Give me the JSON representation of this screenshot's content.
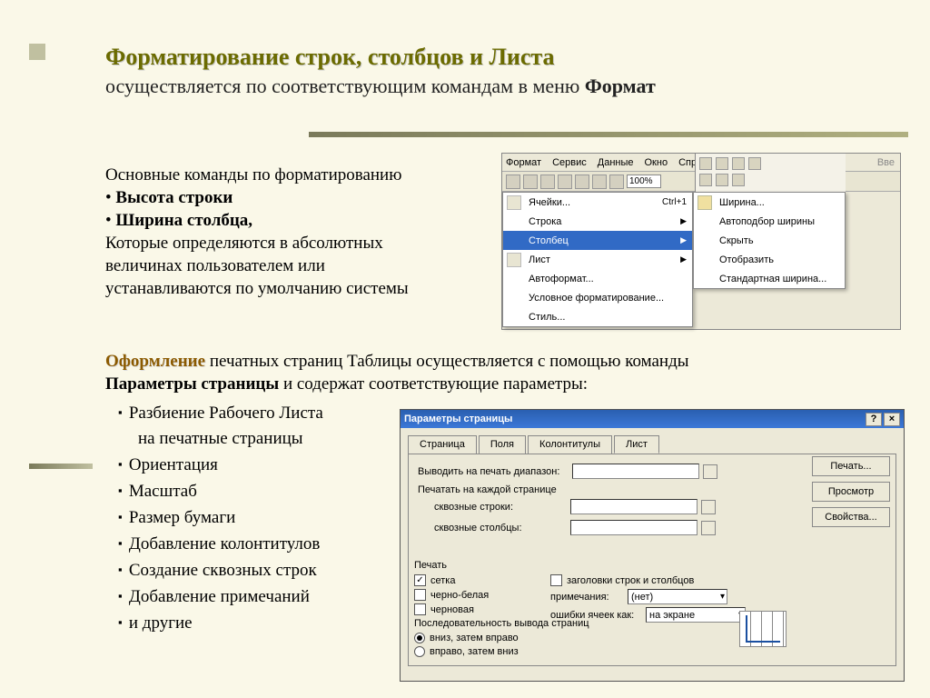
{
  "title": {
    "line1": "Форматирование строк, столбцов и Листа",
    "line2_a": "осуществляется   по соответствующим  командам в меню ",
    "line2_b": "Формат"
  },
  "leftText": {
    "l1": "Основные команды по форматированию",
    "b1": "Высота строки",
    "b2": "Ширина столбца,",
    "l3": "Которые определяются в абсолютных",
    "l4": "величинах пользователем или",
    "l5": "устанавливаются по умолчанию системы"
  },
  "menu": {
    "bar": [
      "Формат",
      "Сервис",
      "Данные",
      "Окно",
      "Справка"
    ],
    "vve": "Вве",
    "zoom": "100%",
    "items": [
      {
        "label": "Ячейки...",
        "shortcut": "Ctrl+1"
      },
      {
        "label": "Строка",
        "sub": true
      },
      {
        "label": "Столбец",
        "sub": true,
        "hl": true
      },
      {
        "label": "Лист",
        "sub": true
      },
      {
        "label": "Автоформат..."
      },
      {
        "label": "Условное форматирование..."
      },
      {
        "label": "Стиль..."
      }
    ],
    "submenu": [
      "Ширина...",
      "Автоподбор ширины",
      "Скрыть",
      "Отобразить",
      "Стандартная ширина..."
    ]
  },
  "mid": {
    "oform": "Оформление",
    "t1": " печатных страниц Таблицы осуществляется с помощью команды",
    "t2a": "Параметры страницы",
    "t2b": " и содержат соответствующие параметры:"
  },
  "bullets": [
    "Разбиение Рабочего Листа",
    "на печатные страницы",
    "Ориентация",
    "Масштаб",
    "Размер бумаги",
    "Добавление колонтитулов",
    "Создание сквозных строк",
    "Добавление примечаний",
    "и другие"
  ],
  "dialog": {
    "title": "Параметры страницы",
    "tabs": [
      "Страница",
      "Поля",
      "Колонтитулы",
      "Лист"
    ],
    "activeTab": 3,
    "buttons": {
      "print": "Печать...",
      "preview": "Просмотр",
      "props": "Свойства..."
    },
    "labels": {
      "rangeOut": "Выводить на печать диапазон:",
      "eachPage": "Печатать на каждой странице",
      "throughRows": "сквозные строки:",
      "throughCols": "сквозные столбцы:",
      "printSection": "Печать",
      "grid": "сетка",
      "headers": "заголовки строк и столбцов",
      "bw": "черно-белая",
      "notes": "примечания:",
      "draft": "черновая",
      "errors": "ошибки ячеек как:",
      "noteVal": "(нет)",
      "errVal": "на экране",
      "seq": "Последовательность вывода страниц",
      "downRight": "вниз, затем вправо",
      "rightDown": "вправо, затем вниз"
    }
  }
}
